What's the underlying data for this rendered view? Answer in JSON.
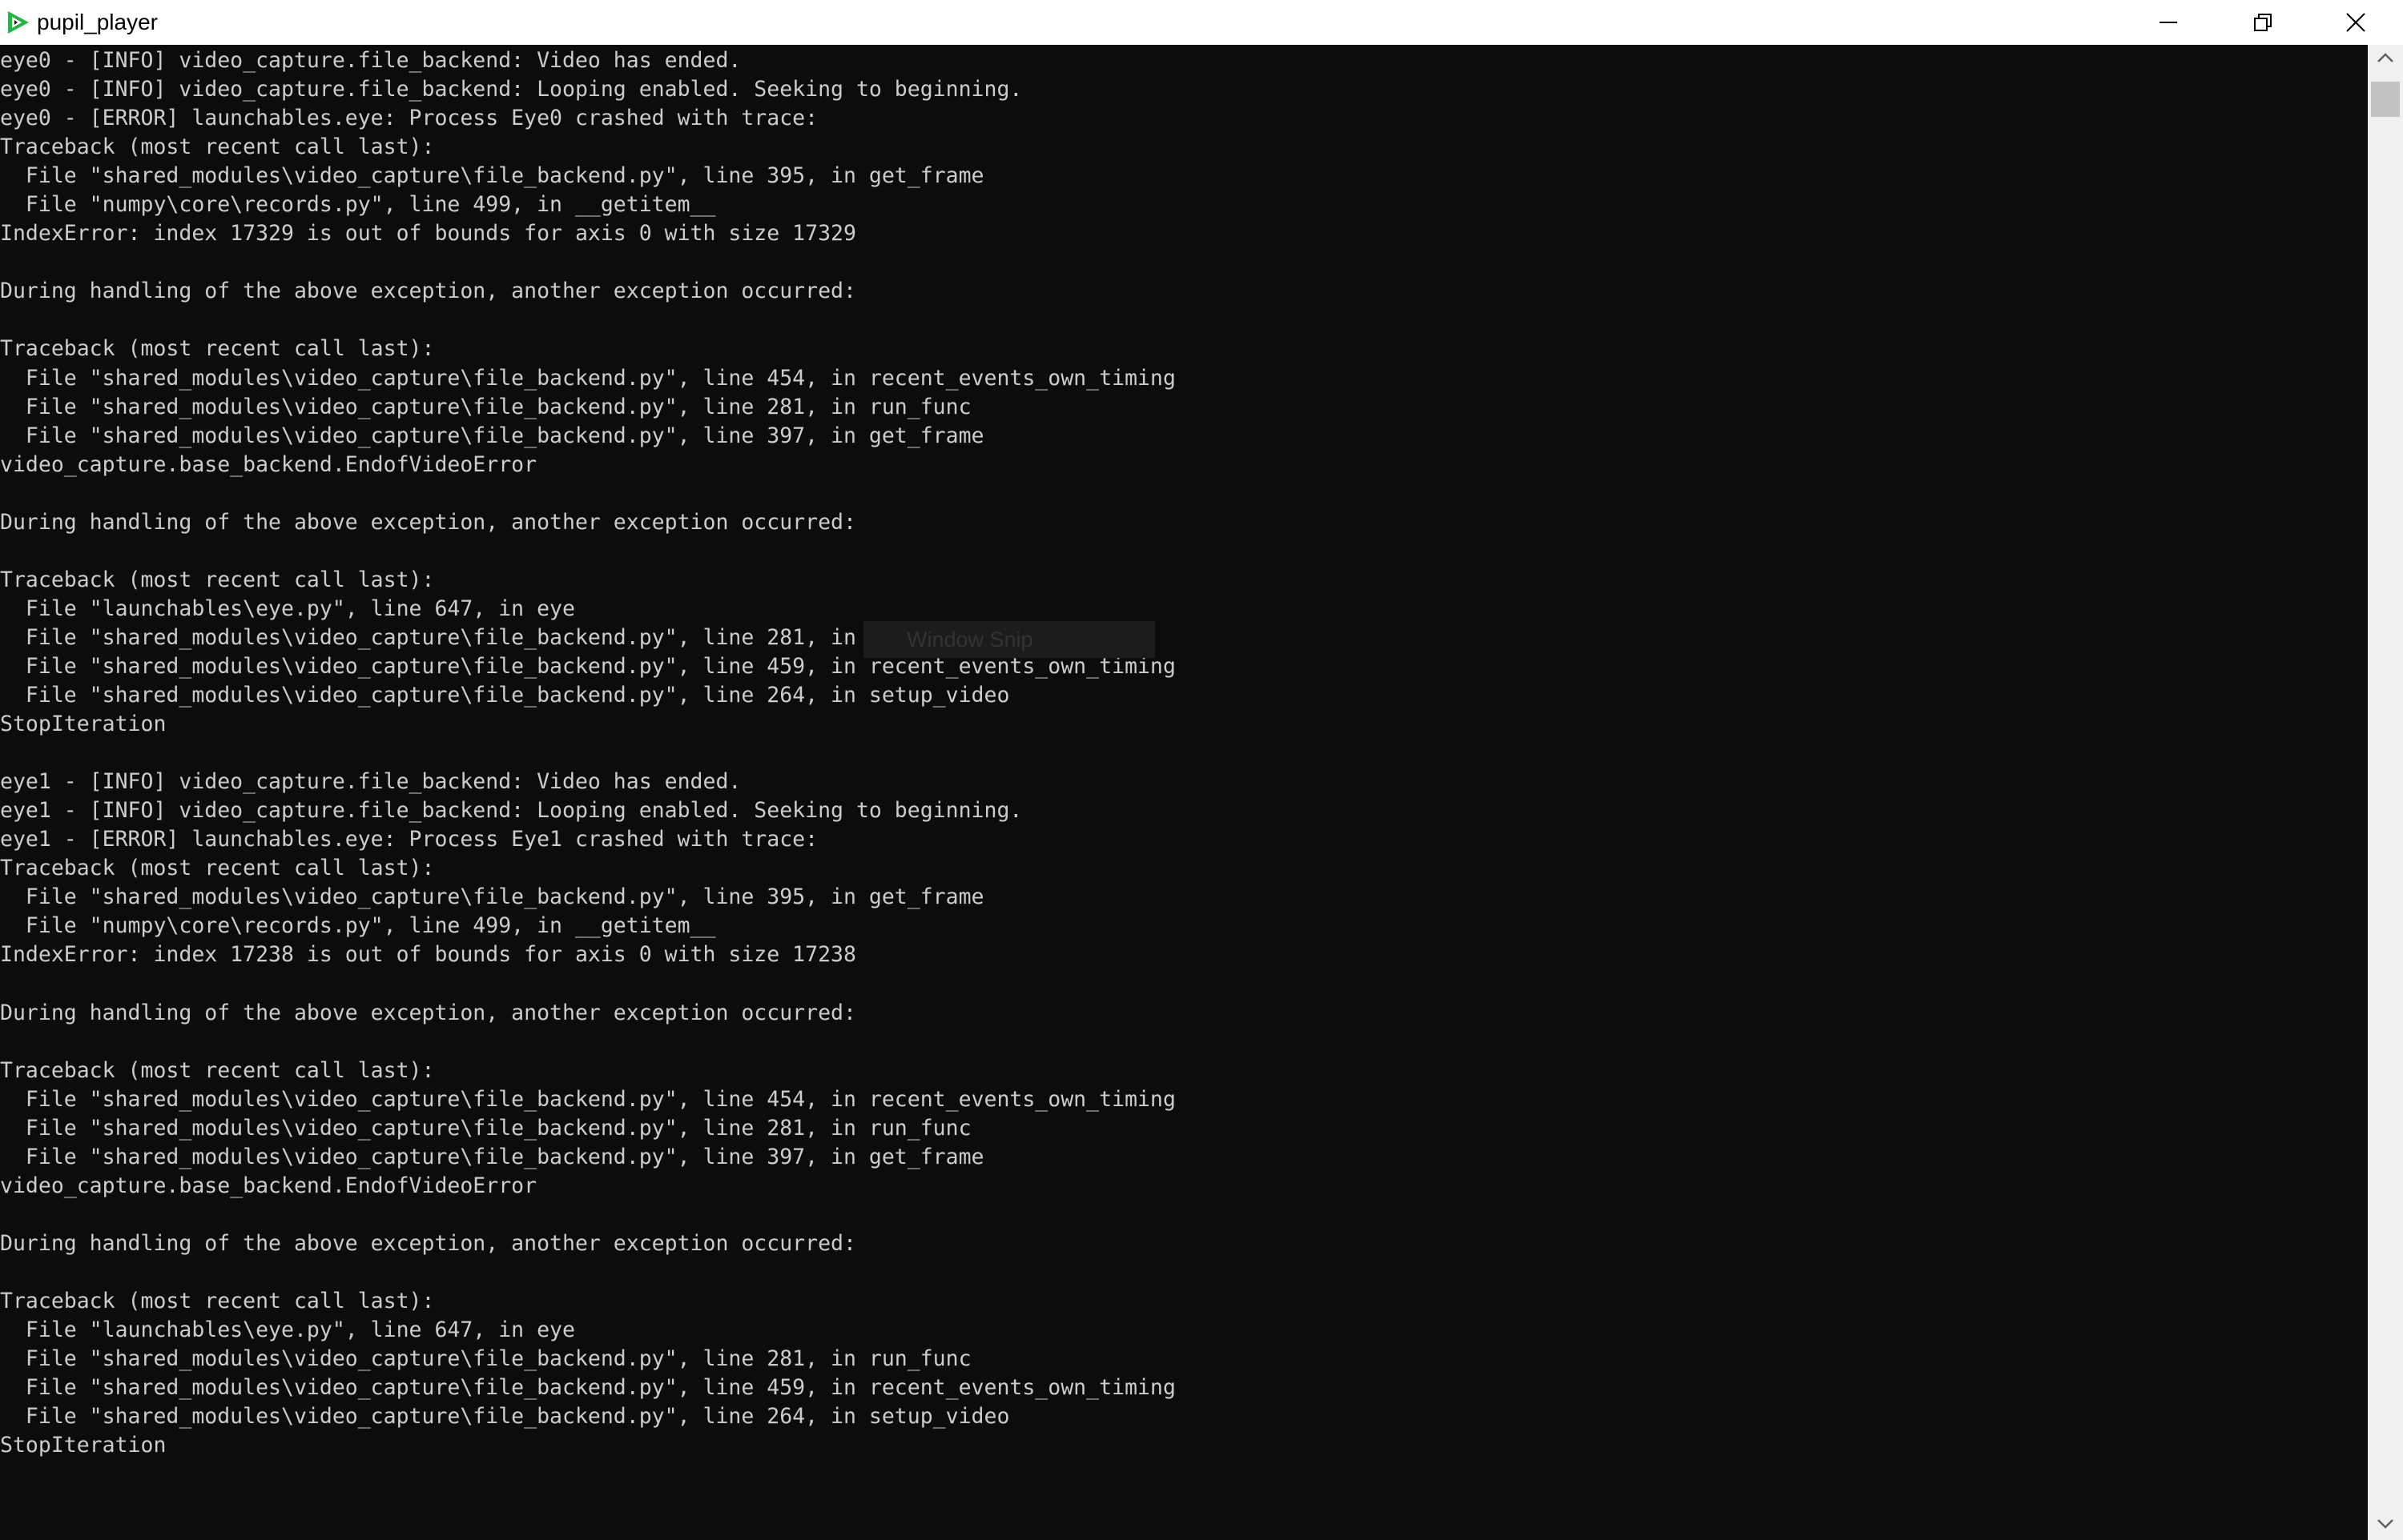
{
  "window": {
    "title": "pupil_player",
    "controls": {
      "minimize_icon": "minimize-icon",
      "restore_icon": "restore-icon",
      "close_icon": "close-icon"
    }
  },
  "colors": {
    "console_background": "#0c0c0c",
    "console_text": "#cccccc",
    "titlebar_background": "#ffffff",
    "app_icon_green": "#2db24a"
  },
  "overlay": {
    "label": "Window Snip"
  },
  "console": {
    "lines": [
      "eye0 - [INFO] video_capture.file_backend: Video has ended.",
      "eye0 - [INFO] video_capture.file_backend: Looping enabled. Seeking to beginning.",
      "eye0 - [ERROR] launchables.eye: Process Eye0 crashed with trace:",
      "Traceback (most recent call last):",
      "  File \"shared_modules\\video_capture\\file_backend.py\", line 395, in get_frame",
      "  File \"numpy\\core\\records.py\", line 499, in __getitem__",
      "IndexError: index 17329 is out of bounds for axis 0 with size 17329",
      "",
      "During handling of the above exception, another exception occurred:",
      "",
      "Traceback (most recent call last):",
      "  File \"shared_modules\\video_capture\\file_backend.py\", line 454, in recent_events_own_timing",
      "  File \"shared_modules\\video_capture\\file_backend.py\", line 281, in run_func",
      "  File \"shared_modules\\video_capture\\file_backend.py\", line 397, in get_frame",
      "video_capture.base_backend.EndofVideoError",
      "",
      "During handling of the above exception, another exception occurred:",
      "",
      "Traceback (most recent call last):",
      "  File \"launchables\\eye.py\", line 647, in eye",
      "  File \"shared_modules\\video_capture\\file_backend.py\", line 281, in run_func",
      "  File \"shared_modules\\video_capture\\file_backend.py\", line 459, in recent_events_own_timing",
      "  File \"shared_modules\\video_capture\\file_backend.py\", line 264, in setup_video",
      "StopIteration",
      "",
      "eye1 - [INFO] video_capture.file_backend: Video has ended.",
      "eye1 - [INFO] video_capture.file_backend: Looping enabled. Seeking to beginning.",
      "eye1 - [ERROR] launchables.eye: Process Eye1 crashed with trace:",
      "Traceback (most recent call last):",
      "  File \"shared_modules\\video_capture\\file_backend.py\", line 395, in get_frame",
      "  File \"numpy\\core\\records.py\", line 499, in __getitem__",
      "IndexError: index 17238 is out of bounds for axis 0 with size 17238",
      "",
      "During handling of the above exception, another exception occurred:",
      "",
      "Traceback (most recent call last):",
      "  File \"shared_modules\\video_capture\\file_backend.py\", line 454, in recent_events_own_timing",
      "  File \"shared_modules\\video_capture\\file_backend.py\", line 281, in run_func",
      "  File \"shared_modules\\video_capture\\file_backend.py\", line 397, in get_frame",
      "video_capture.base_backend.EndofVideoError",
      "",
      "During handling of the above exception, another exception occurred:",
      "",
      "Traceback (most recent call last):",
      "  File \"launchables\\eye.py\", line 647, in eye",
      "  File \"shared_modules\\video_capture\\file_backend.py\", line 281, in run_func",
      "  File \"shared_modules\\video_capture\\file_backend.py\", line 459, in recent_events_own_timing",
      "  File \"shared_modules\\video_capture\\file_backend.py\", line 264, in setup_video",
      "StopIteration"
    ]
  }
}
